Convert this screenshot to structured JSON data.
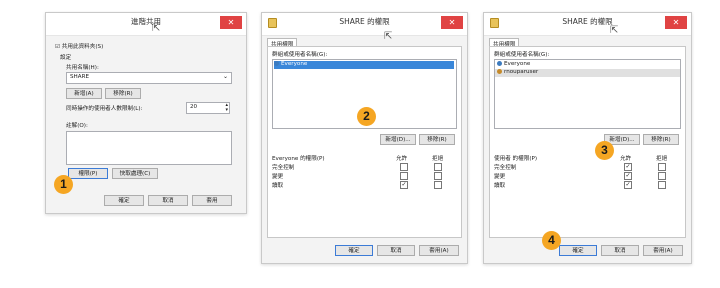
{
  "dialog1": {
    "title": "進階共用",
    "close": "✕",
    "share_checkbox_label": "☑ 共用此資料夾(S)",
    "settings_label": "設定",
    "share_name_label": "共用名稱(H):",
    "share_name_value": "SHARE",
    "add_button": "新增(A)",
    "remove_button": "移除(R)",
    "limit_label": "同時操作的使用者人數限制(L):",
    "limit_value": "20",
    "comments_label": "註解(O):",
    "permissions_button": "權限(P)",
    "cache_button": "快取處理(C)",
    "ok_button": "確定",
    "cancel_button": "取消",
    "apply_button": "套用",
    "badge": "1"
  },
  "dialog2": {
    "title": "SHARE 的權限",
    "close": "✕",
    "tab": "共用權限",
    "group_label": "群組或使用者名稱(G):",
    "users": [
      "Everyone"
    ],
    "add_button": "新增(D)...",
    "remove_button": "移除(R)",
    "perm_header": "Everyone 的權限(P)",
    "allow_header": "允許",
    "deny_header": "拒絕",
    "perms": [
      "完全控制",
      "變更",
      "讀取"
    ],
    "ok_button": "確定",
    "cancel_button": "取消",
    "apply_button": "套用(A)",
    "badge": "2"
  },
  "dialog3": {
    "title": "SHARE 的權限",
    "close": "✕",
    "tab": "共用權限",
    "group_label": "群組或使用者名稱(G):",
    "users": [
      "Everyone",
      "rnouparuser"
    ],
    "add_button": "新增(D)...",
    "remove_button": "移除(R)",
    "perm_header": "使用者 的權限(P)",
    "allow_header": "允許",
    "deny_header": "拒絕",
    "perms": [
      "完全控制",
      "變更",
      "讀取"
    ],
    "ok_button": "確定",
    "cancel_button": "取消",
    "apply_button": "套用(A)",
    "badge3": "3",
    "badge4": "4"
  },
  "check_mark": "✓"
}
